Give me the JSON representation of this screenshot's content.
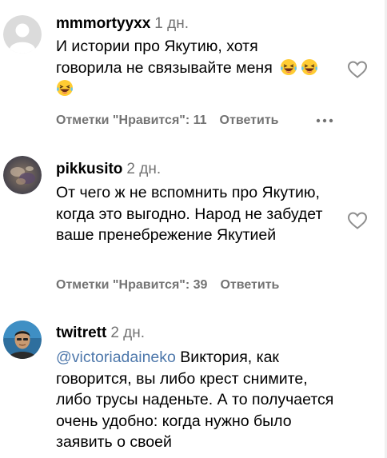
{
  "comments": [
    {
      "username": "mmmortyyxx",
      "time": "1 дн.",
      "text_lines": [
        "И истории про Якутию, хотя",
        "говорила не связывайте меня"
      ],
      "likes_label": "Отметки \"Нравится\": 11",
      "reply_label": "Ответить",
      "emoji_icon": "grinning-squinting-face-with-tears-emoji"
    },
    {
      "username": "pikkusito",
      "time": "2 дн.",
      "text": "От чего ж не вспомнить про Якутию, когда это выгодно. Народ не забудет ваше пренебрежение Якутией",
      "likes_label": "Отметки \"Нравится\": 39",
      "reply_label": "Ответить"
    },
    {
      "username": "twitrett",
      "time": "2 дн.",
      "mention": "@victoriadaineko",
      "text": " Виктория, как говорится, вы либо крест снимите, либо трусы наденьте. А то получается очень удобно: когда нужно было заявить о своей"
    }
  ],
  "colors": {
    "text": "#000000",
    "secondary": "#737373",
    "mention": "#4e78ab",
    "heart_stroke": "#8e8e8e",
    "background": "#ffffff"
  }
}
